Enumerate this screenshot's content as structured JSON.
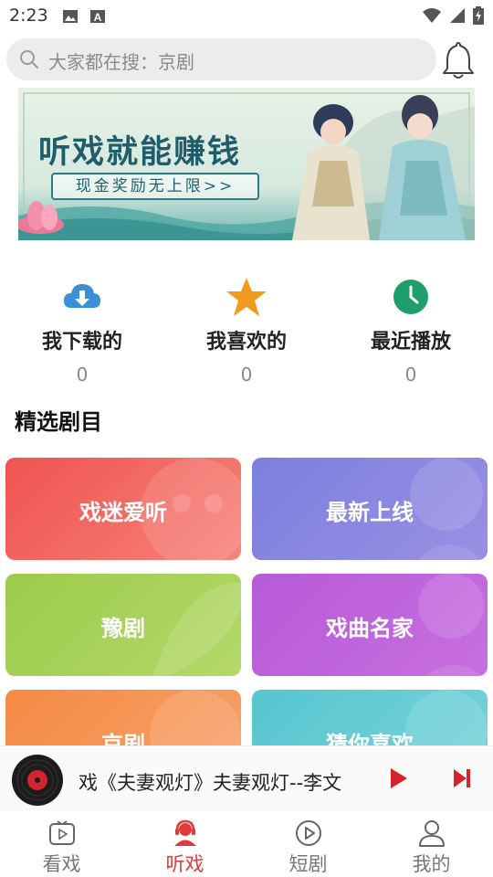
{
  "status_bar": {
    "time": "2:23"
  },
  "search": {
    "placeholder": "大家都在搜：京剧"
  },
  "banner": {
    "title": "听戏就能赚钱",
    "subtitle": "现金奖励无上限>>"
  },
  "quick_actions": [
    {
      "label": "我下载的",
      "count": "0",
      "icon": "download-cloud-icon",
      "color": "#3a8fd8"
    },
    {
      "label": "我喜欢的",
      "count": "0",
      "icon": "star-icon",
      "color": "#f29a1e"
    },
    {
      "label": "最近播放",
      "count": "0",
      "icon": "clock-icon",
      "color": "#1f9d6b"
    }
  ],
  "section": {
    "title": "精选剧目"
  },
  "categories": [
    {
      "label": "戏迷爱听",
      "color_from": "#ef5350",
      "color_to": "#f7837a"
    },
    {
      "label": "最新上线",
      "color_from": "#7b80dd",
      "color_to": "#9a8fe4"
    },
    {
      "label": "豫剧",
      "color_from": "#9ccc4b",
      "color_to": "#b4d86a"
    },
    {
      "label": "戏曲名家",
      "color_from": "#b65ad6",
      "color_to": "#c86fe0"
    },
    {
      "label": "京剧",
      "color_from": "#f58a45",
      "color_to": "#f7a36b"
    },
    {
      "label": "猜你喜欢",
      "color_from": "#56c6cf",
      "color_to": "#7ad3db"
    }
  ],
  "player": {
    "title": "戏《夫妻观灯》夫妻观灯--李文"
  },
  "tabs": [
    {
      "label": "看戏",
      "icon": "tv-icon",
      "active": false
    },
    {
      "label": "听戏",
      "icon": "headset-user-icon",
      "active": true
    },
    {
      "label": "短剧",
      "icon": "play-circle-icon",
      "active": false
    },
    {
      "label": "我的",
      "icon": "person-icon",
      "active": false
    }
  ],
  "colors": {
    "accent": "#e03a3a",
    "search_bg": "#ececec"
  }
}
